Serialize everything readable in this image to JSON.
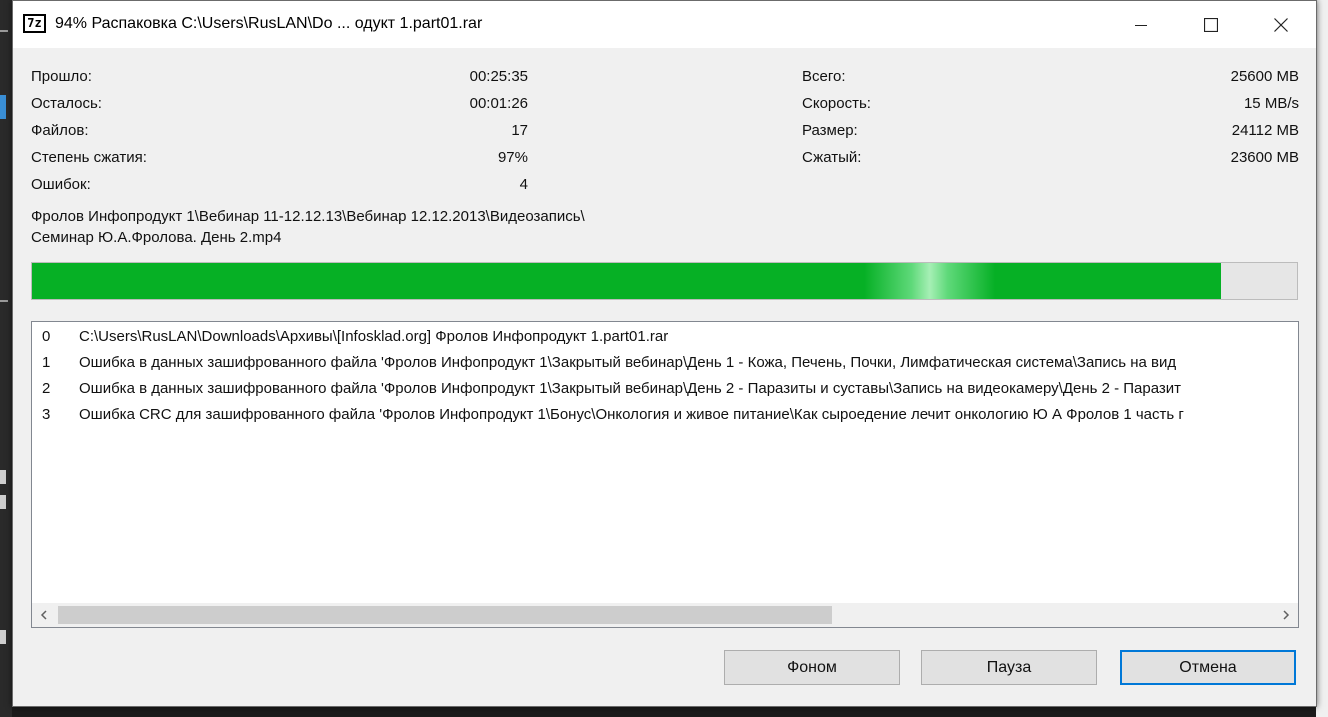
{
  "window": {
    "title": "94% Распаковка C:\\Users\\RusLAN\\Do ... одукт 1.part01.rar",
    "icon_text": "7z"
  },
  "stats_left": [
    {
      "label": "Прошло:",
      "value": "00:25:35"
    },
    {
      "label": "Осталось:",
      "value": "00:01:26"
    },
    {
      "label": "Файлов:",
      "value": "17"
    },
    {
      "label": "Степень сжатия:",
      "value": "97%"
    },
    {
      "label": "Ошибок:",
      "value": "4"
    }
  ],
  "stats_right": [
    {
      "label": "Всего:",
      "value": "25600 MB"
    },
    {
      "label": "Скорость:",
      "value": "15 MB/s"
    },
    {
      "label": "Размер:",
      "value": "24112 MB"
    },
    {
      "label": "Сжатый:",
      "value": "23600 MB"
    }
  ],
  "current_file": {
    "line1": "Фролов Инфопродукт 1\\Вебинар 11-12.12.13\\Вебинар 12.12.2013\\Видеозапись\\",
    "line2": "Семинар Ю.А.Фролова. День 2.mp4"
  },
  "progress": {
    "percent": 94,
    "color": "#06b025"
  },
  "log": [
    {
      "index": "0",
      "text": "C:\\Users\\RusLAN\\Downloads\\Архивы\\[Infosklad.org] Фролов Инфопродукт 1.part01.rar"
    },
    {
      "index": "1",
      "text": "Ошибка в данных зашифрованного файла 'Фролов Инфопродукт 1\\Закрытый вебинар\\День 1 - Кожа, Печень, Почки, Лимфатическая система\\Запись на вид"
    },
    {
      "index": "2",
      "text": "Ошибка в данных зашифрованного файла 'Фролов Инфопродукт 1\\Закрытый вебинар\\День 2 - Паразиты и суставы\\Запись на видеокамеру\\День 2 - Паразит"
    },
    {
      "index": "3",
      "text": "Ошибка CRC для зашифрованного файла 'Фролов Инфопродукт 1\\Бонус\\Онкология и живое питание\\Как сыроедение лечит онкологию Ю А Фролов 1 часть г"
    }
  ],
  "buttons": {
    "background": "Фоном",
    "pause": "Пауза",
    "cancel": "Отмена"
  },
  "colors": {
    "accent": "#0078d7"
  }
}
